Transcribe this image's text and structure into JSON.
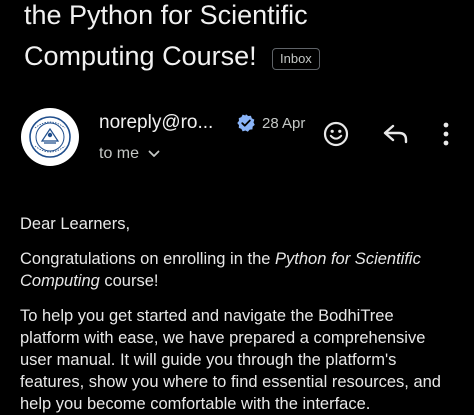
{
  "email": {
    "subject_line1": "the Python for Scientific",
    "subject_line2": "Computing Course!",
    "label_badge": "Inbox",
    "sender": "noreply@ro...",
    "date": "28 Apr",
    "recipient": "to me",
    "greeting": "Dear Learners,",
    "para1": {
      "prefix": "Congratulations on enrolling in the ",
      "course_italic_1": "Python for Scientific",
      "course_italic_2": "Computing",
      "suffix": " course!"
    },
    "para2": {
      "line1": "To help you get started and navigate the BodhiTree",
      "line2": "platform with ease, we have prepared a comprehensive",
      "line3": "user manual. It will guide you through the platform's",
      "line4": "features, show you where to find essential resources, and",
      "line5": "help you become comfortable with the interface."
    }
  },
  "icons": {
    "avatar": "institute-seal-logo",
    "verified": "verified-check-icon",
    "expand": "chevron-down-icon",
    "emoji": "emoji-smile-icon",
    "reply": "reply-icon",
    "more": "more-vert-icon"
  },
  "colors": {
    "background": "#000000",
    "text_primary": "#f1f1f1",
    "text_secondary": "#c4c7c5",
    "verified_blue": "#8ab4f8"
  }
}
